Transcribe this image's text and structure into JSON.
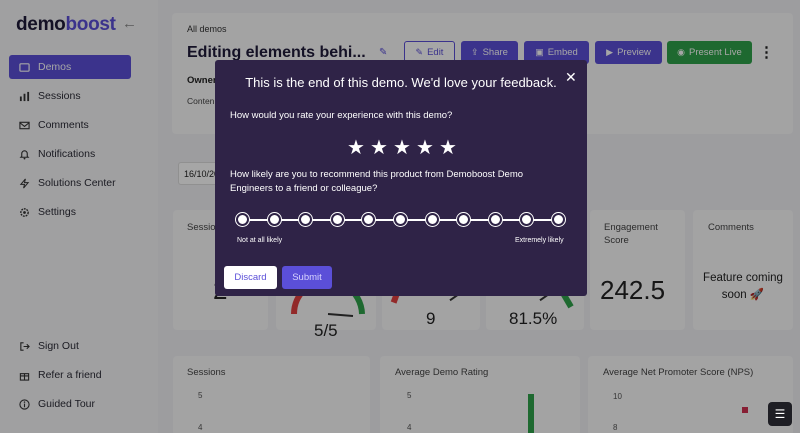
{
  "brand": {
    "part1": "demo",
    "part2": "boost"
  },
  "sidebar": {
    "collapse_glyph": "←",
    "items": [
      {
        "label": "Demos",
        "icon": "demos-icon"
      },
      {
        "label": "Sessions",
        "icon": "bar-chart-icon"
      },
      {
        "label": "Comments",
        "icon": "mail-icon"
      },
      {
        "label": "Notifications",
        "icon": "bell-icon"
      },
      {
        "label": "Solutions Center",
        "icon": "bolt-icon"
      },
      {
        "label": "Settings",
        "icon": "gear-icon"
      }
    ],
    "bottom_items": [
      {
        "label": "Sign Out",
        "icon": "sign-out-icon"
      },
      {
        "label": "Refer a friend",
        "icon": "gift-icon"
      },
      {
        "label": "Guided Tour",
        "icon": "info-icon"
      }
    ]
  },
  "header": {
    "breadcrumb": "All demos",
    "title": "Editing elements behi...",
    "owner_label": "Owner",
    "content_label": "Conten",
    "buttons": {
      "edit": "Edit",
      "share": "Share",
      "embed": "Embed",
      "preview": "Preview",
      "present": "Present Live"
    },
    "more_glyph": "⋮"
  },
  "filters": {
    "date": "16/10/20"
  },
  "stats": {
    "sessions_label": "Sessio",
    "sessions_value": "2",
    "rating_value": "5/5",
    "count_value": "9",
    "percent_value": "81.5%",
    "engagement_label": "Engagement Score",
    "engagement_value": "242.5",
    "comments_label": "Comments",
    "comments_value": "Feature coming soon 🚀"
  },
  "charts": {
    "sessions": {
      "title": "Sessions",
      "ticks": [
        "5",
        "4"
      ]
    },
    "rating": {
      "title": "Average Demo Rating",
      "ticks": [
        "5",
        "4"
      ]
    },
    "nps": {
      "title": "Average Net Promoter Score (NPS)",
      "ticks": [
        "10",
        "8"
      ]
    }
  },
  "modal": {
    "title": "This is the end of this demo. We'd love your feedback.",
    "close_glyph": "✕",
    "rating_question": "How would you rate your experience with this demo?",
    "rating_stars": 5,
    "nps_question": "How likely are you to recommend this product from Demoboost Demo Engineers to a friend or colleague?",
    "nps_points": 11,
    "low_label": "Not at all likely",
    "high_label": "Extremely likely",
    "discard_label": "Discard",
    "submit_label": "Submit"
  },
  "colors": {
    "accent": "#5b4fd8",
    "modal_bg": "#2f2347",
    "present": "#2fa24a"
  },
  "fab_glyph": "☰"
}
